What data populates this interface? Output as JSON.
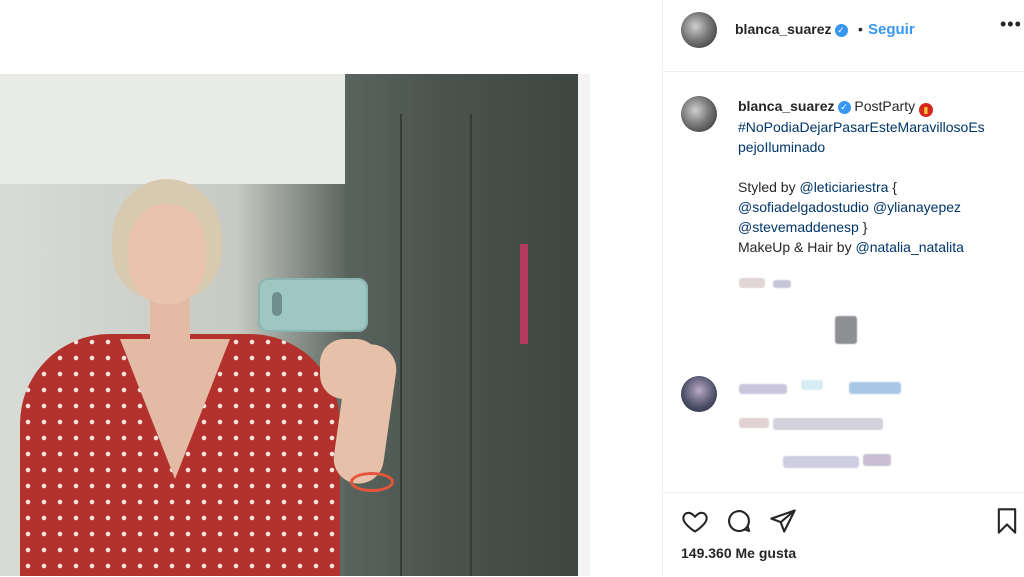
{
  "header": {
    "username": "blanca_suarez",
    "separator": "•",
    "follow_label": "Seguir",
    "more_label": "•••"
  },
  "caption": {
    "username": "blanca_suarez",
    "line1_text": "PostParty",
    "hashtag_line1": "#NoPodiaDejarPasarEsteMaravillosoEs",
    "hashtag_line2": "pejoIluminado",
    "styled_by": "Styled by",
    "mention1": "@leticiariestra",
    "brace_open": "{",
    "mention2": "@sofiadelgadostudio",
    "mention3": "@ylianayepez",
    "mention4": "@stevemaddenesp",
    "brace_close": "}",
    "makeup_text": "MakeUp & Hair by",
    "mention5": "@natalia_natalita"
  },
  "actions": {
    "likes": "149.360 Me gusta"
  },
  "icons": [
    "verified-icon",
    "heart-icon",
    "comment-icon",
    "share-icon",
    "bookmark-icon",
    "more-icon"
  ],
  "colors": {
    "accent": "#3897f0",
    "link": "#003569",
    "text": "#262626",
    "border": "#efefef"
  }
}
